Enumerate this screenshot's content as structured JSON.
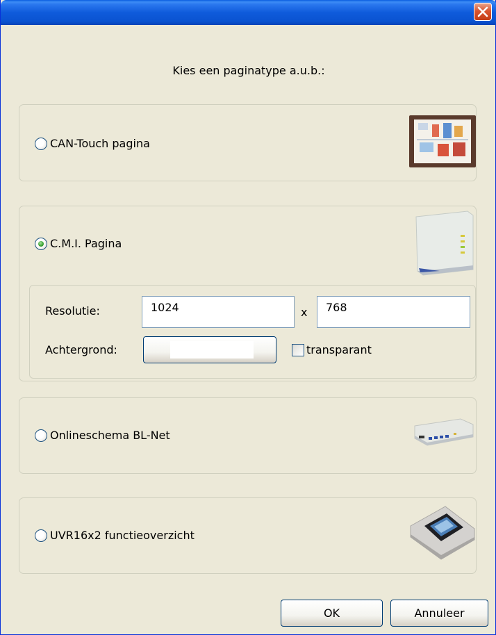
{
  "dialog": {
    "prompt": "Kies een paginatype a.u.b.:"
  },
  "options": {
    "can_touch": {
      "label": "CAN-Touch pagina",
      "selected": false
    },
    "cmi": {
      "label": "C.M.I. Pagina",
      "selected": true
    },
    "blnet": {
      "label": "Onlineschema BL-Net",
      "selected": false
    },
    "uvr": {
      "label": "UVR16x2 functieoverzicht",
      "selected": false
    }
  },
  "cmi_settings": {
    "resolution_label": "Resolutie:",
    "width": "1024",
    "separator": "x",
    "height": "768",
    "background_label": "Achtergrond:",
    "background_color": "#ffffff",
    "transparent_label": "transparant",
    "transparent_checked": false
  },
  "buttons": {
    "ok": "OK",
    "cancel": "Annuleer"
  },
  "icons": {
    "close": "close-icon",
    "can_touch": "can-touch-panel-icon",
    "cmi": "cmi-device-icon",
    "blnet": "bl-net-device-icon",
    "uvr": "uvr16x2-controller-icon"
  }
}
